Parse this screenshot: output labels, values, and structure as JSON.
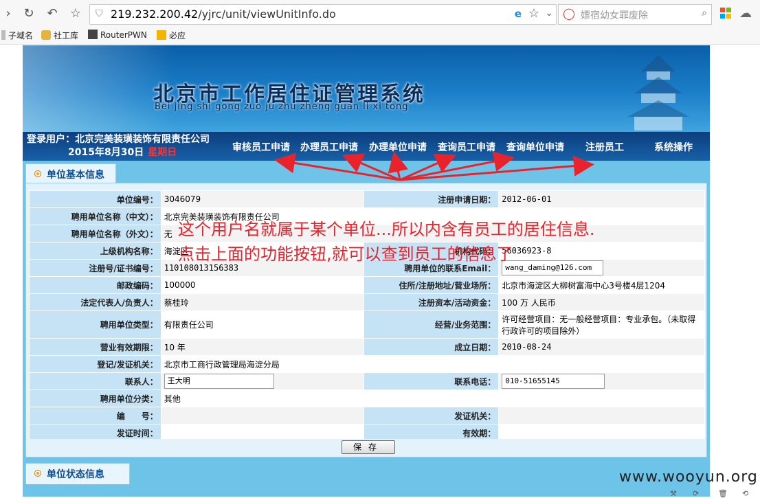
{
  "browser": {
    "url_host": "219.232.200.42",
    "url_path": "/yjrc/unit/viewUnitInfo.do",
    "search_placeholder": "嫖宿幼女罪废除",
    "bookmarks": [
      "子域名",
      "社工库",
      "RouterPWN",
      "必应"
    ]
  },
  "header": {
    "title": "北京市工作居住证管理系统",
    "pinyin": "Bei jing shi gong zuo ju zhu zheng guan li xi tong",
    "login_label": "登录用户：北京完美装璜装饰有限责任公司",
    "date": "2015年8月30日",
    "weekday": "星期日"
  },
  "menu": [
    "审核员工申请",
    "办理员工申请",
    "办理单位申请",
    "查询员工申请",
    "查询单位申请",
    "注册员工",
    "系统操作"
  ],
  "section1_title": "单位基本信息",
  "section2_title": "单位状态信息",
  "form": {
    "rows": [
      {
        "l1": "单位编号：",
        "v1": "3046079",
        "l2": "注册申请日期：",
        "v2": "2012-06-01"
      },
      {
        "l1": "聘用单位名称（中文）：",
        "v1": "北京完美装璜装饰有限责任公司",
        "l2": "",
        "v2": ""
      },
      {
        "l1": "聘用单位名称（外文）：",
        "v1": "无",
        "l2": "",
        "v2": ""
      },
      {
        "l1": "上级机构名称：",
        "v1": "海淀区",
        "l2": "机构代码：",
        "v2": "56036923-8"
      },
      {
        "l1": "注册号/证书编号：",
        "v1": "110108013156383",
        "l2": "聘用单位的联系Email：",
        "v2": "wang_daming@126.com"
      },
      {
        "l1": "邮政编码：",
        "v1": "100000",
        "l2": "住所/注册地址/营业场所：",
        "v2": "北京市海淀区大柳树富海中心3号楼4层1204"
      },
      {
        "l1": "法定代表人/负责人：",
        "v1": "蔡桂玲",
        "l2": "注册资本/活动资金：",
        "v2": "100 万   人民币"
      },
      {
        "l1": "聘用单位类型：",
        "v1": "有限责任公司",
        "l2": "经营/业务范围：",
        "v2": "许可经营项目：无一般经营项目：专业承包。（未取得行政许可的项目除外）"
      },
      {
        "l1": "营业有效期限：",
        "v1": "10 年",
        "l2": "成立日期：",
        "v2": "2010-08-24"
      },
      {
        "l1": "登记/发证机关：",
        "v1": "北京市工商行政管理局海淀分局",
        "l2": "",
        "v2": ""
      },
      {
        "l1": "联系人：",
        "v1": "王大明",
        "l2": "联系电话：",
        "v2": "010-51655145"
      },
      {
        "l1": "聘用单位分类：",
        "v1": "其他",
        "l2": "",
        "v2": ""
      },
      {
        "l1": "编　　号：",
        "v1": "",
        "l2": "发证机关：",
        "v2": ""
      },
      {
        "l1": "发证时间：",
        "v1": "",
        "l2": "有效期：",
        "v2": ""
      }
    ],
    "save_label": "保存"
  },
  "annotation": {
    "line1": "这个用户名就属于某个单位...所以内含有员工的居住信息.",
    "line2": "点击上面的功能按钮,就可以查到员工的信息了"
  },
  "watermark": "www.wooyun.org",
  "colors": {
    "annotation": "#e8232b",
    "menu_bg": "#0d3e7d",
    "label_bg": "#c6e3f5"
  }
}
